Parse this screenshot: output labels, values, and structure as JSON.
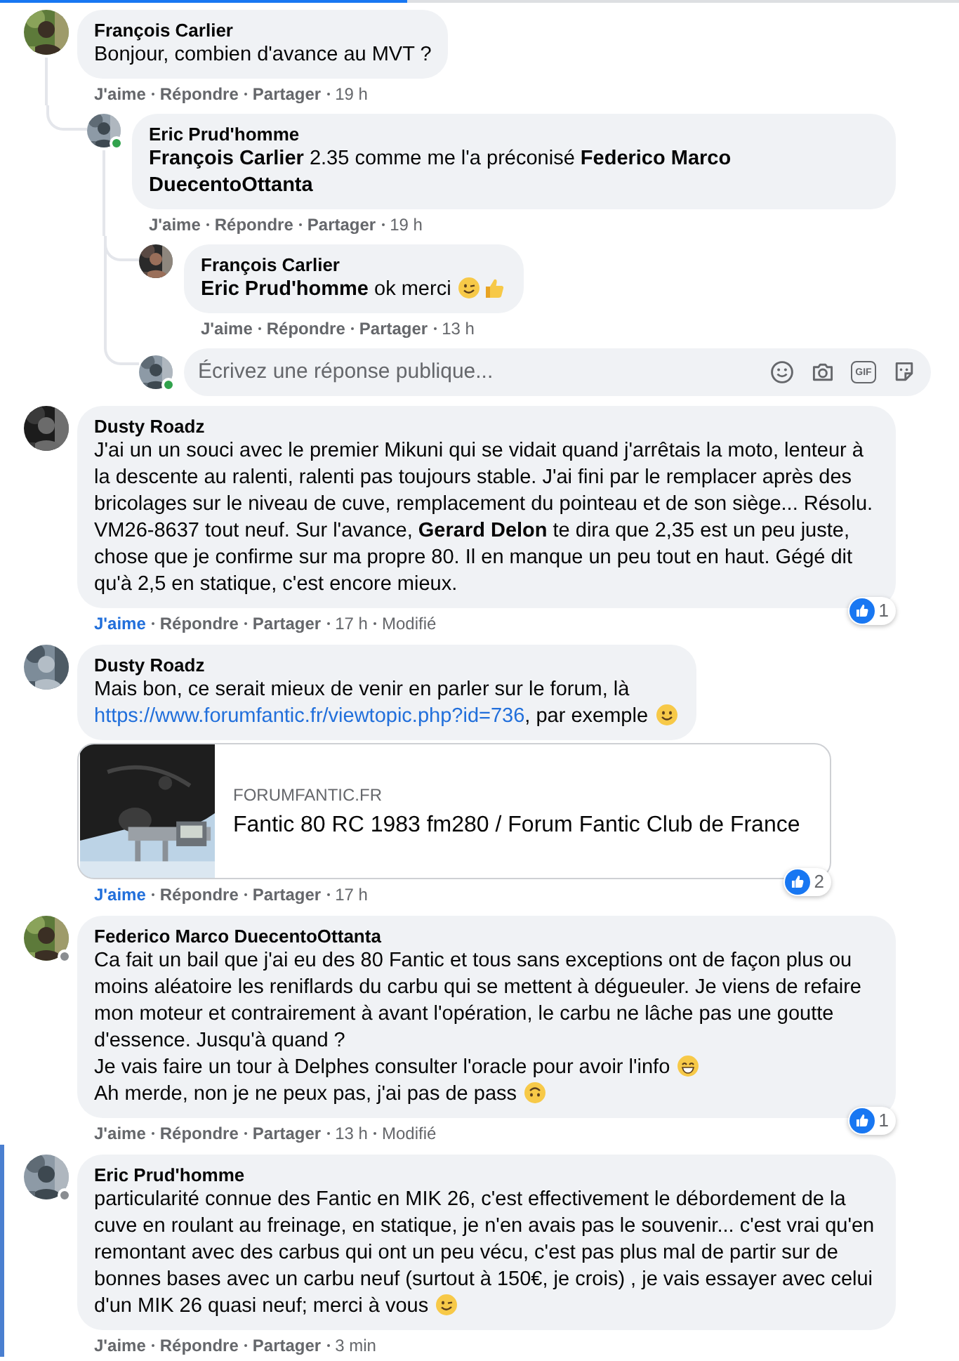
{
  "comments": [
    {
      "author": "François Carlier",
      "highlighted": false,
      "body": [
        {
          "kind": "text",
          "text": "Bonjour, combien d'avance au MVT ?"
        }
      ],
      "actions": {
        "like": "J'aime",
        "liked": false,
        "reply": "Répondre",
        "share": "Partager",
        "time": "19 h"
      },
      "replies": [
        {
          "author": "Eric Prud'homme",
          "color": "#31a24c",
          "body": [
            {
              "kind": "text",
              "text": "**François Carlier** 2.35 comme me l'a préconisé **Federico Marco DuecentoOttanta**"
            }
          ],
          "actions": {
            "like": "J'aime",
            "liked": false,
            "reply": "Répondre",
            "share": "Partager",
            "time": "19 h"
          },
          "replies": [
            {
              "author": "François Carlier",
              "body": [
                {
                  "kind": "text",
                  "text": "**Eric Prud'homme** ok merci "
                },
                {
                  "kind": "wink"
                },
                {
                  "kind": "thumbs_up"
                }
              ],
              "actions": {
                "like": "J'aime",
                "liked": false,
                "reply": "Répondre",
                "share": "Partager",
                "time": "13 h"
              }
            }
          ],
          "reply_box": {
            "placeholder": "Écrivez une réponse publique...",
            "gif_label": "GIF",
            "color": "#31a24c"
          }
        }
      ]
    },
    {
      "author": "Dusty Roadz",
      "highlighted": false,
      "body": [
        {
          "kind": "text",
          "text": "J'ai un un souci avec le premier Mikuni qui se vidait quand j'arrêtais la moto, lenteur à la descente au ralenti, ralenti pas toujours stable. J'ai fini par le remplacer après des bricolages sur le niveau de cuve, remplacement du pointeau et de son siège... Résolu. VM26-8637 tout neuf. Sur l'avance, **Gerard Delon** te dira que 2,35 est un peu juste, chose que je confirme sur ma propre 80. Il en manque un peu tout en haut. Gégé dit qu'à 2,5 en statique, c'est encore mieux."
        }
      ],
      "actions": {
        "like": "J'aime",
        "liked": true,
        "reply": "Répondre",
        "share": "Partager",
        "time": "17 h",
        "edited": "Modifié"
      },
      "reactions": "1"
    },
    {
      "author": "Dusty Roadz",
      "highlighted": false,
      "body": [
        {
          "kind": "text",
          "text": "Mais bon, ce serait mieux de venir en parler sur le forum, là"
        },
        {
          "kind": "break"
        },
        {
          "kind": "link",
          "text": "https://www.forumfantic.fr/viewtopic.php?id=736"
        },
        {
          "kind": "text",
          "text": ", par exemple "
        },
        {
          "kind": "smile"
        }
      ],
      "link_preview": {
        "kind": "picture",
        "domain": "FORUMFANTIC.FR",
        "title": "Fantic 80 RC 1983 fm280 / Forum Fantic Club de France"
      },
      "actions": {
        "like": "J'aime",
        "liked": true,
        "reply": "Répondre",
        "share": "Partager",
        "time": "17 h"
      },
      "reactions": "2"
    },
    {
      "author": "Federico Marco DuecentoOttanta",
      "color": "#8a8d91",
      "highlighted": false,
      "body": [
        {
          "kind": "text",
          "text": "Ca fait un bail que j'ai eu des 80 Fantic et tous sans exceptions ont de façon plus ou moins aléatoire les reniflards du carbu qui se mettent à dégueuler. Je viens de refaire mon moteur et contrairement à avant l'opération, le carbu ne lâche pas une goutte d'essence. Jusqu'à quand ?"
        },
        {
          "kind": "break"
        },
        {
          "kind": "text",
          "text": "Je vais faire un tour à Delphes consulter l'oracle pour avoir l'info "
        },
        {
          "kind": "grin"
        },
        {
          "kind": "break"
        },
        {
          "kind": "text",
          "text": "Ah merde, non je ne peux pas, j'ai pas de pass "
        },
        {
          "kind": "upside_down"
        }
      ],
      "actions": {
        "like": "J'aime",
        "liked": false,
        "reply": "Répondre",
        "share": "Partager",
        "time": "13 h",
        "edited": "Modifié"
      },
      "reactions": "1"
    },
    {
      "author": "Eric Prud'homme",
      "color": "#8a8d91",
      "highlighted": true,
      "body": [
        {
          "kind": "text",
          "text": "particularité connue des Fantic en MIK 26, c'est effectivement le débordement de la cuve en roulant au freinage, en statique, je n'en avais pas le souvenir... c'est vrai qu'en remontant avec des carbus qui ont un peu vécu, c'est pas plus mal de partir sur de bonnes bases avec un carbu neuf (surtout à 150€, je crois) , je vais essayer avec celui d'un MIK 26 quasi neuf; merci à vous "
        },
        {
          "kind": "wink"
        }
      ],
      "actions": {
        "like": "J'aime",
        "liked": false,
        "reply": "Répondre",
        "share": "Partager",
        "time": "3 min"
      }
    }
  ]
}
